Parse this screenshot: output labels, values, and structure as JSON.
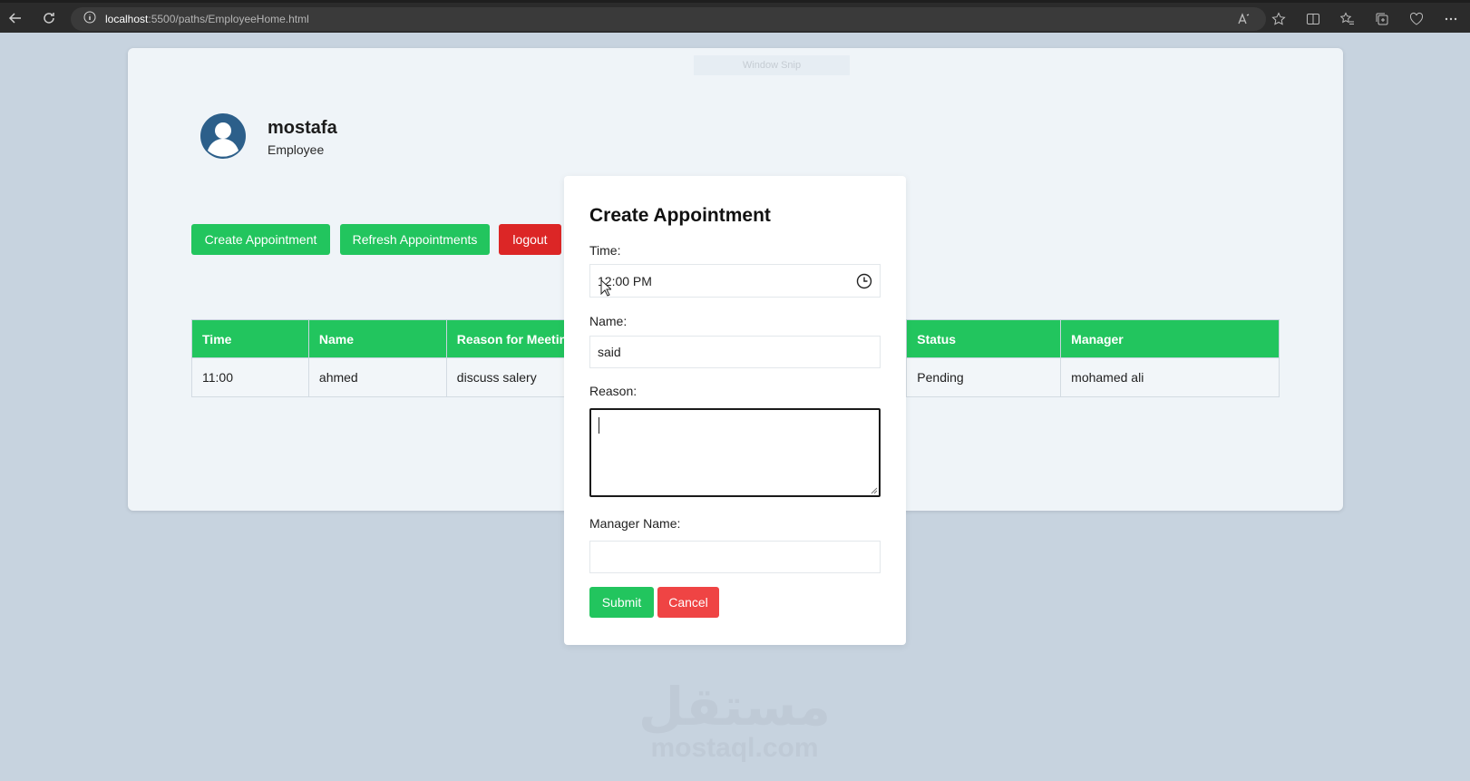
{
  "browser": {
    "url_host": "localhost",
    "url_path": ":5500/paths/EmployeeHome.html"
  },
  "overlay": {
    "snip_label": "Window Snip"
  },
  "user": {
    "name": "mostafa",
    "role": "Employee"
  },
  "actions": {
    "create_label": "Create Appointment",
    "refresh_label": "Refresh Appointments",
    "logout_label": "logout"
  },
  "table": {
    "headers": [
      "Time",
      "Name",
      "Reason for Meetin",
      "Status",
      "Manager"
    ],
    "rows": [
      [
        "11:00",
        "ahmed",
        "discuss salery",
        "Pending",
        "mohamed ali"
      ]
    ]
  },
  "modal": {
    "title": "Create Appointment",
    "time_label": "Time:",
    "time_value": "12:00 PM",
    "name_label": "Name:",
    "name_value": "said",
    "reason_label": "Reason:",
    "reason_value": "",
    "manager_label": "Manager Name:",
    "manager_value": "",
    "submit_label": "Submit",
    "cancel_label": "Cancel"
  },
  "watermark": {
    "arabic": "مستقل",
    "latin": "mostaql.com"
  },
  "colors": {
    "green": "#22c55e",
    "red": "#dc2626",
    "cancel_red": "#ef4444"
  }
}
